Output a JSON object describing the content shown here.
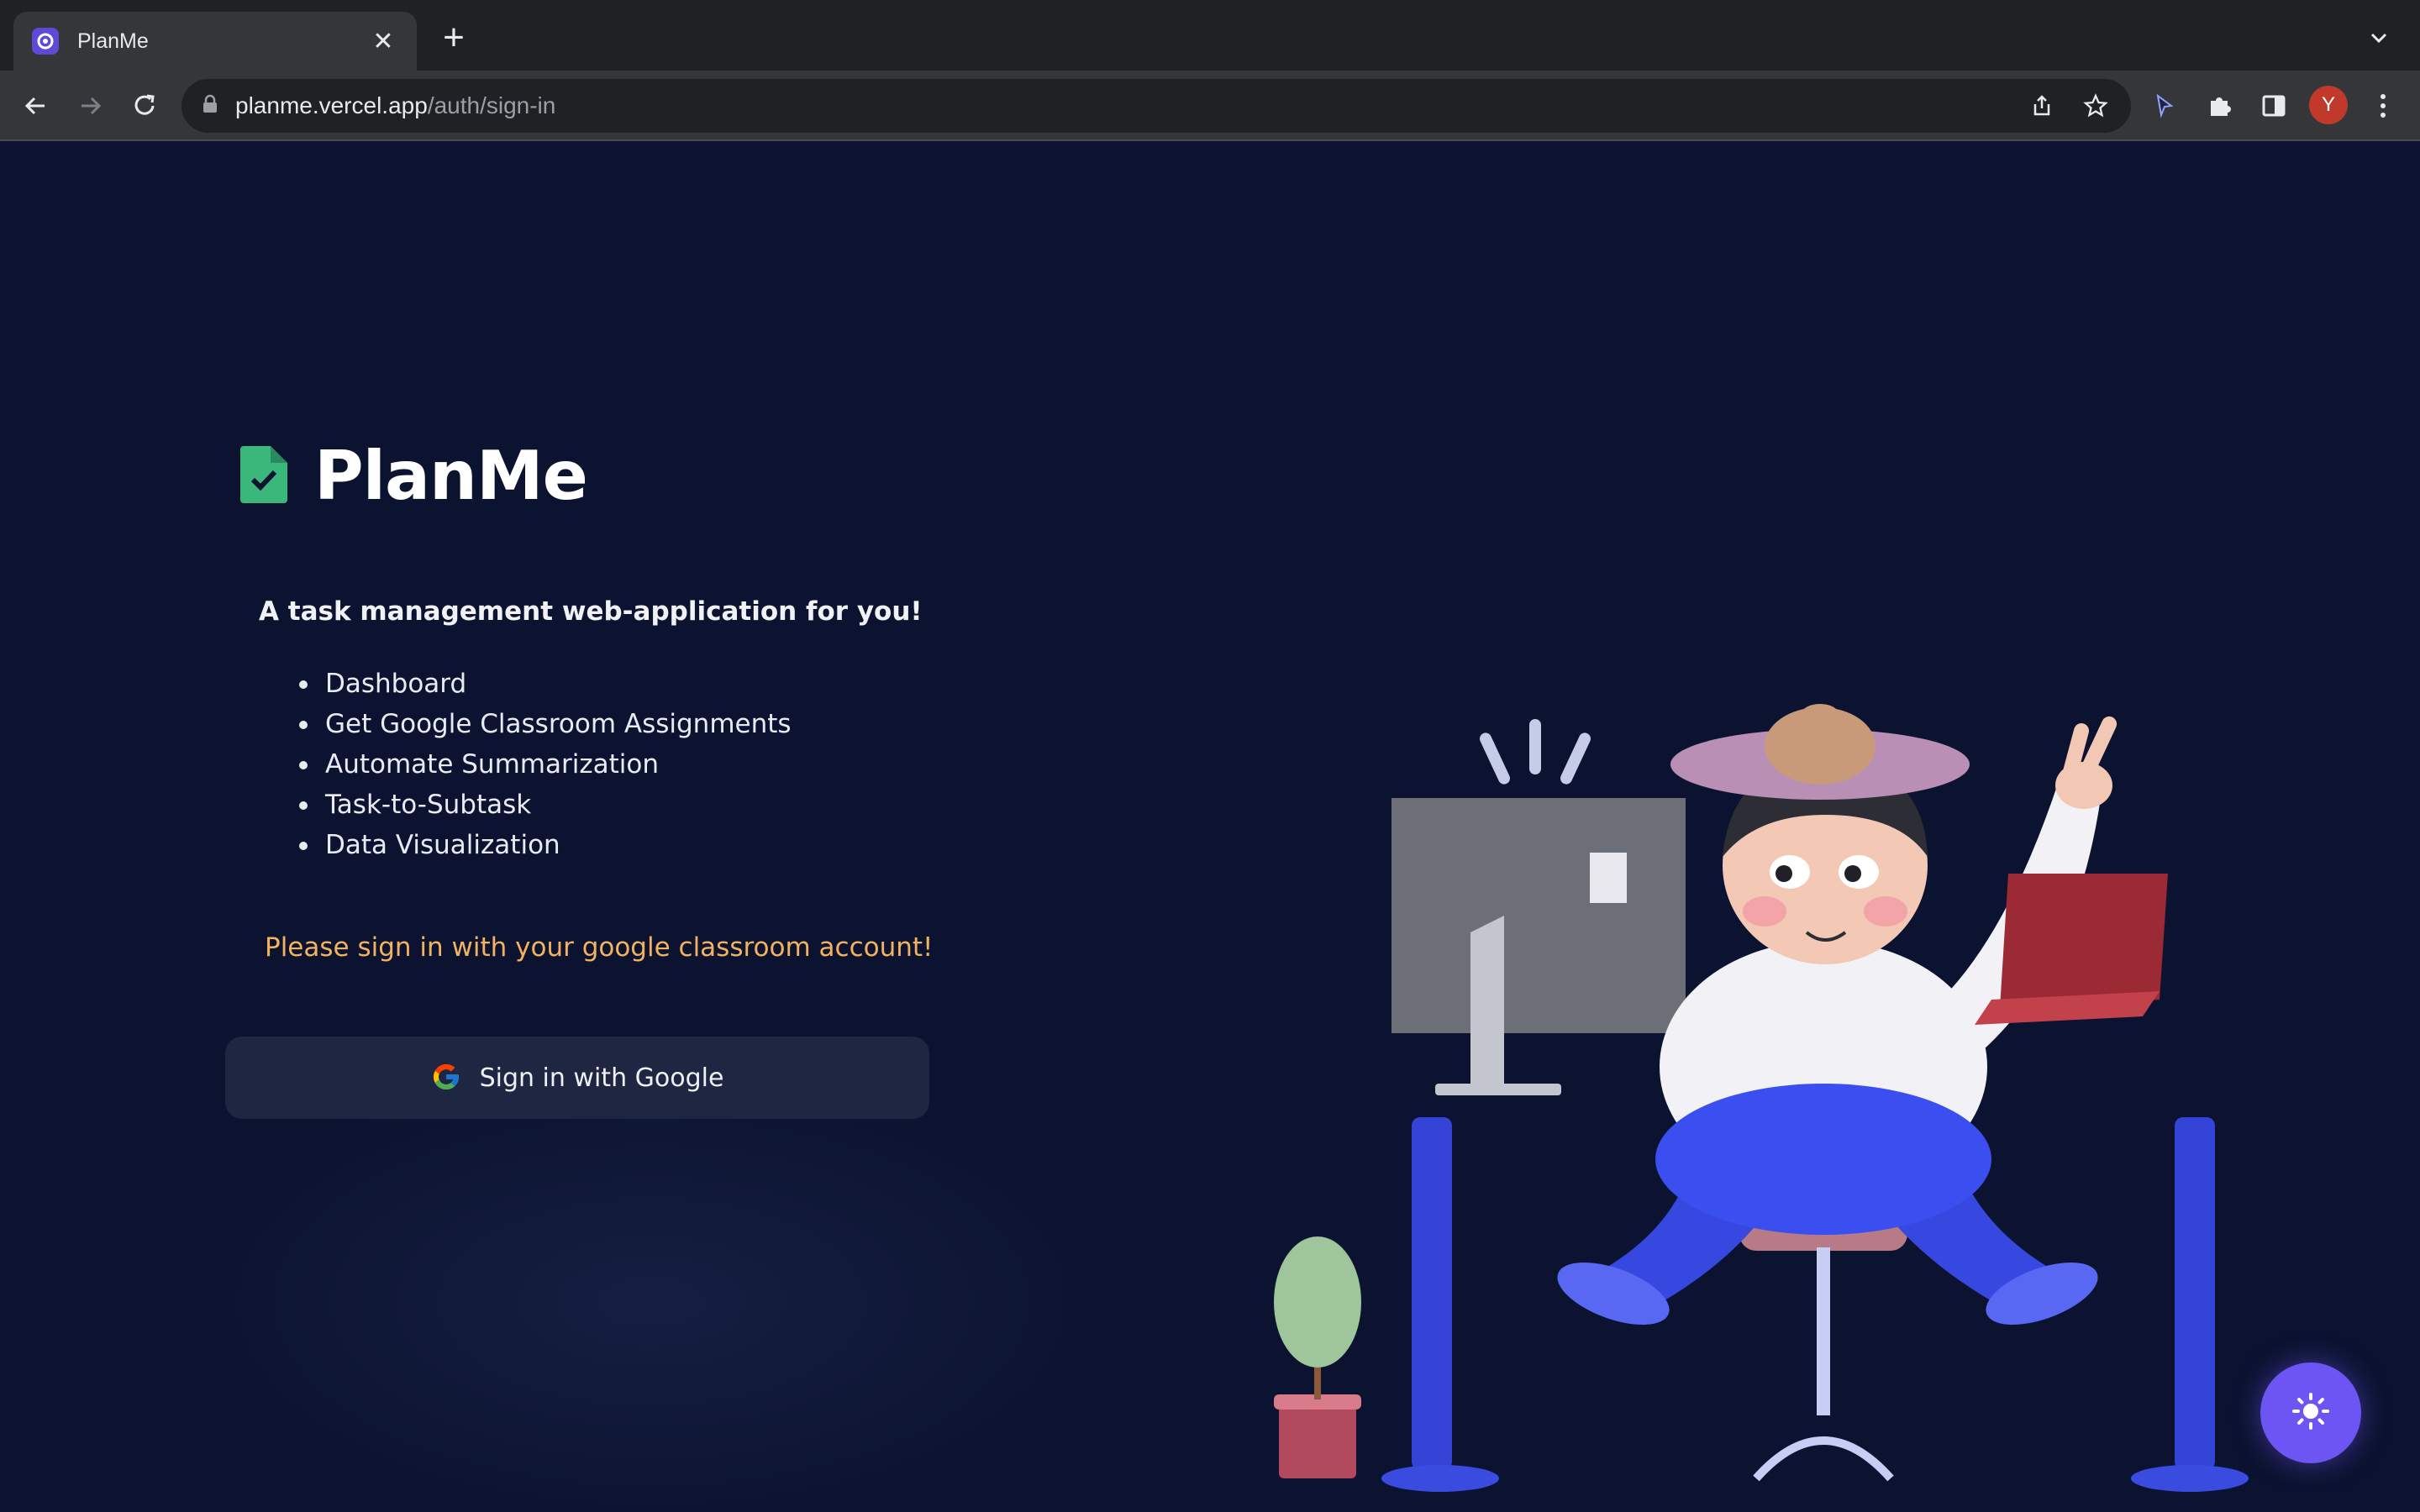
{
  "browser": {
    "tab_title": "PlanMe",
    "url_host": "planme.vercel.app",
    "url_path": "/auth/sign-in",
    "profile_initial": "Y"
  },
  "app": {
    "title": "PlanMe",
    "tagline": "A task management web-application for you!",
    "features": [
      "Dashboard",
      "Get Google Classroom Assignments",
      "Automate Summarization",
      "Task-to-Subtask",
      "Data Visualization"
    ],
    "notice": "Please sign in with your google classroom account!",
    "sign_in_label": "Sign in with Google"
  },
  "colors": {
    "background": "#0c1331",
    "notice": "#f3b25e",
    "logo": "#3cb77b",
    "theme_button": "#6d55f3",
    "desk": "#3b4ee0"
  },
  "icons": {
    "logo": "file-check-icon",
    "theme_toggle": "sun-icon",
    "sign_in": "google-icon"
  }
}
